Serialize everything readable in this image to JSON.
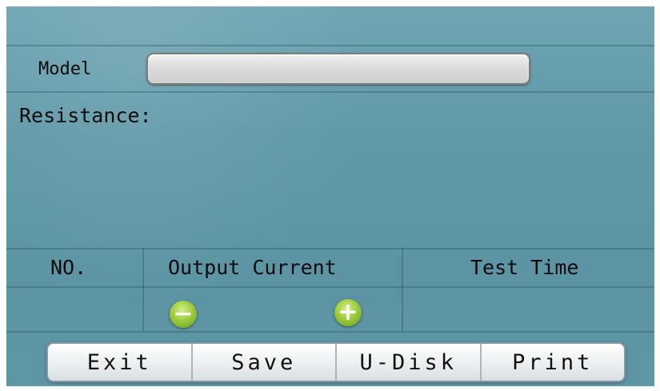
{
  "model": {
    "label": "Model",
    "value": ""
  },
  "resistance": {
    "label": "Resistance:"
  },
  "table": {
    "headers": [
      "NO.",
      "Output Current",
      "Test Time"
    ]
  },
  "current_controls": {
    "decrease_symbol": "−",
    "increase_symbol": "+"
  },
  "toolbar": {
    "buttons": [
      "Exit",
      "Save",
      "U-Disk",
      "Print"
    ]
  },
  "colors": {
    "background": "#5f98a7",
    "accent_green": "#9fcc3f",
    "text": "#0b0b0b"
  }
}
